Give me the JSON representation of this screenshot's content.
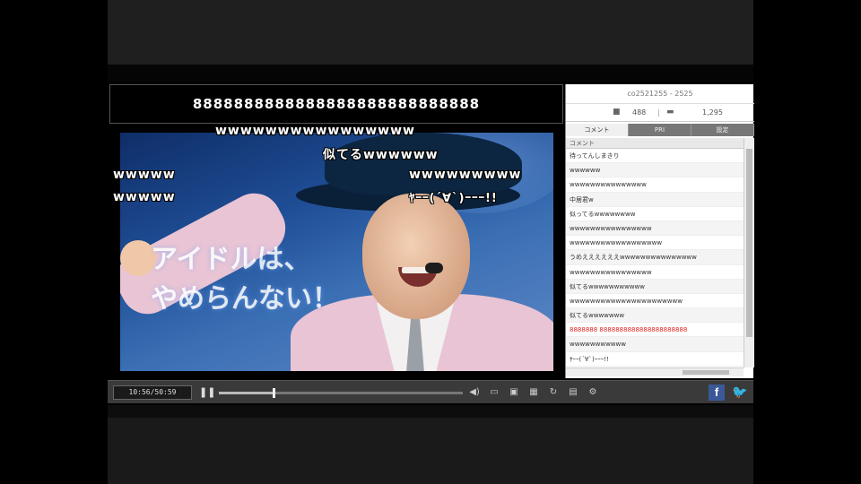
{
  "marquee": "8888888888888888888888888888",
  "video": {
    "promo_line1": "アイドルは、",
    "promo_line2": "やめらんない！"
  },
  "danmaku": [
    "wwwwwwwwwwwwwwww",
    "似てるwwwwww",
    "wwwww",
    "wwwwwwwww",
    "wwwww",
    "ﾔｰｰ(´∀`)ｰｰｰ!!"
  ],
  "controls": {
    "time": "10:56/50:59",
    "pause_glyph": "❚❚",
    "seek_fraction": 0.22,
    "facebook_glyph": "f",
    "twitter_glyph": "🐦"
  },
  "side": {
    "header": "co2521255 - 2525",
    "viewers": "488",
    "comments": "1,295",
    "tabs": [
      "コメント",
      "PRI",
      "設定"
    ],
    "column_header": "コメント",
    "comments_list": [
      "待ってんしまきり",
      "wwwwww",
      "wwwwwwwwwwwwwww",
      "中居君w",
      "似ってるwwwwwwww",
      "wwwwwwwwwwwwwwww",
      "wwwwwwwwwwwwwwwwww",
      "うめええええええwwwwwwwwwwwwwww",
      "wwwwwwwwwwwwwwww",
      "似てるwwwwwwwwwww",
      "wwwwwwwwwwwwwwwwwwwwww",
      "似てるwwwwwww",
      "8888888 8888888888888888888888",
      "wwwwwwwwwww",
      "ﾔｰｰ(´∀`)ｰｰｰ!!"
    ],
    "red_row_index": 12
  },
  "colors": {
    "accent_red": "#dd2222",
    "facebook": "#3b5998",
    "twitter": "#1da1f2"
  }
}
